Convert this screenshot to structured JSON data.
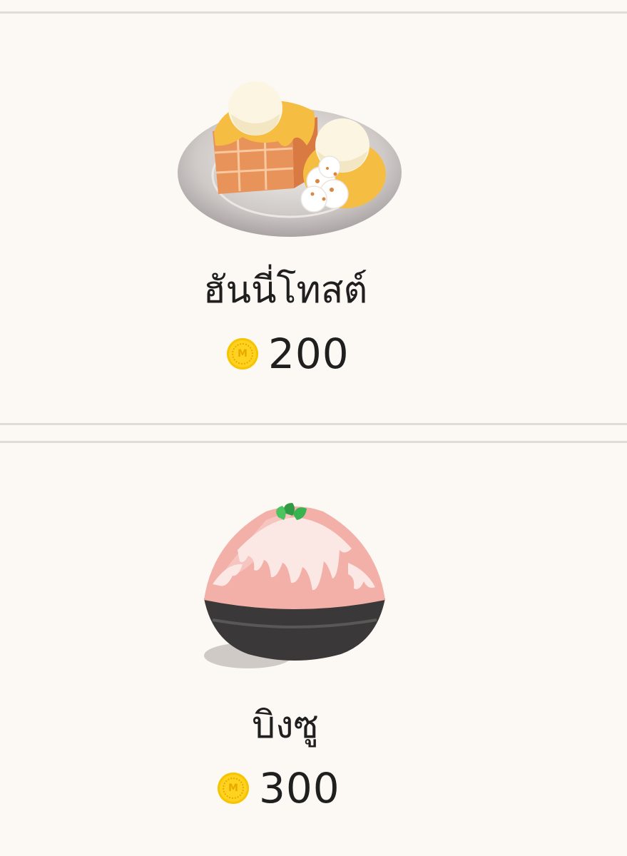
{
  "items": [
    {
      "name": "ฮันนี่โทสต์",
      "price": "200",
      "icon": "honey-toast-icon",
      "coin_icon": "m-coin-icon",
      "coin_letter": "M"
    },
    {
      "name": "บิงซู",
      "price": "300",
      "icon": "bingsu-icon",
      "coin_icon": "m-coin-icon",
      "coin_letter": "M"
    }
  ],
  "colors": {
    "background": "#fcf8f3",
    "divider": "#e0dcd9",
    "coin": "#ffd21f",
    "text": "#1f1f1f"
  }
}
